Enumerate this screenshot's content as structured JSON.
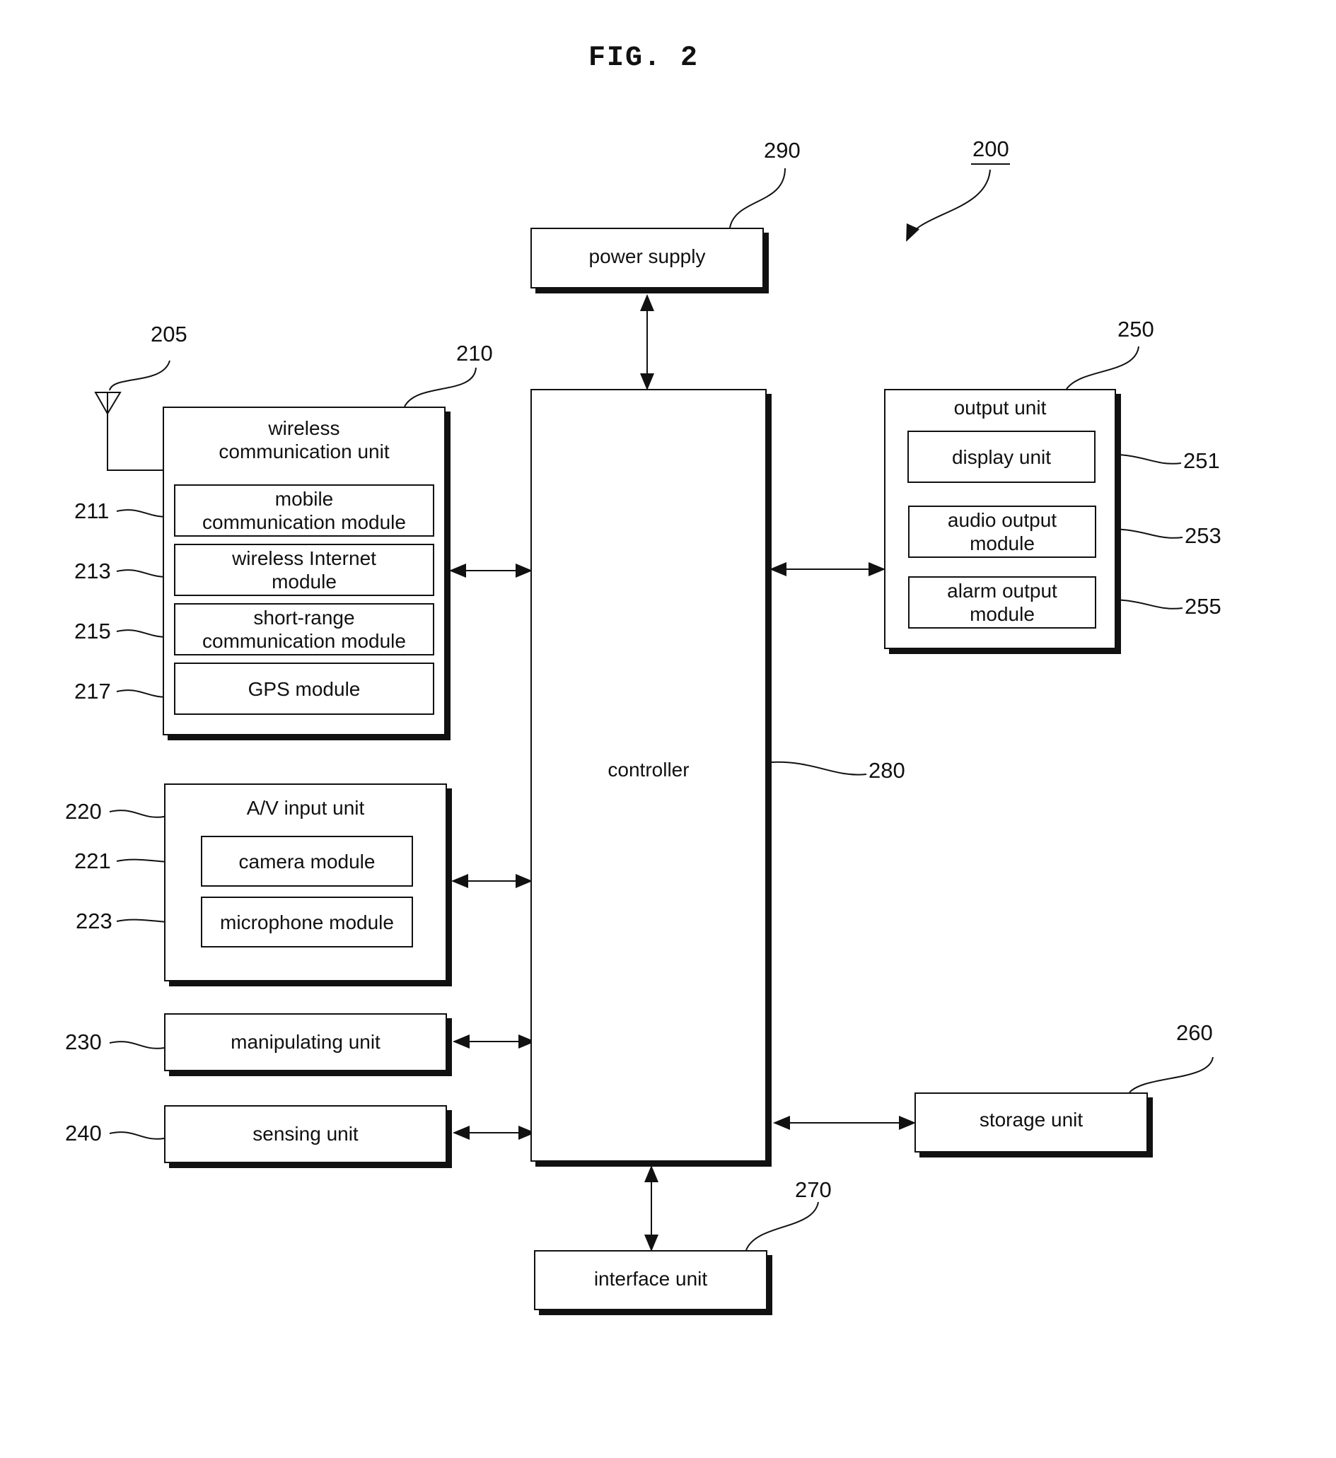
{
  "figure": {
    "title": "FIG. 2",
    "ref": "200"
  },
  "antenna": {
    "ref": "205"
  },
  "wireless_unit": {
    "ref": "210",
    "label": "wireless\ncommunication unit",
    "modules": [
      {
        "ref": "211",
        "label": "mobile\ncommunication module"
      },
      {
        "ref": "213",
        "label": "wireless Internet\nmodule"
      },
      {
        "ref": "215",
        "label": "short-range\ncommunication module"
      },
      {
        "ref": "217",
        "label": "GPS module"
      }
    ]
  },
  "av_input_unit": {
    "ref": "220",
    "label": "A/V input unit",
    "modules": [
      {
        "ref": "221",
        "label": "camera module"
      },
      {
        "ref": "223",
        "label": "microphone module"
      }
    ]
  },
  "manipulating_unit": {
    "ref": "230",
    "label": "manipulating unit"
  },
  "sensing_unit": {
    "ref": "240",
    "label": "sensing unit"
  },
  "output_unit": {
    "ref": "250",
    "label": "output unit",
    "modules": [
      {
        "ref": "251",
        "label": "display unit"
      },
      {
        "ref": "253",
        "label": "audio output\nmodule"
      },
      {
        "ref": "255",
        "label": "alarm output\nmodule"
      }
    ]
  },
  "storage_unit": {
    "ref": "260",
    "label": "storage unit"
  },
  "interface_unit": {
    "ref": "270",
    "label": "interface unit"
  },
  "controller": {
    "ref": "280",
    "label": "controller"
  },
  "power_supply": {
    "ref": "290",
    "label": "power supply"
  }
}
